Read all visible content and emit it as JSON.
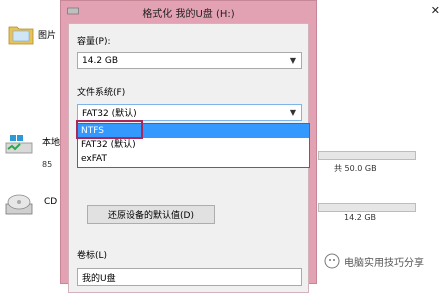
{
  "explorer": {
    "items": [
      {
        "label": "图片"
      },
      {
        "label": "本地"
      },
      {
        "label": "CD"
      }
    ],
    "drive_details": [
      {
        "prefix": "85",
        "free": "共 50.0 GB"
      },
      {
        "prefix": "",
        "free": "14.2 GB"
      }
    ],
    "close_symbol": "✕"
  },
  "dialog": {
    "title": "格式化 我的U盘 (H:)",
    "capacity_label": "容量(P):",
    "capacity_value": "14.2 GB",
    "filesystem_label": "文件系统(F)",
    "filesystem_value": "FAT32 (默认)",
    "filesystem_options": [
      "NTFS",
      "FAT32 (默认)",
      "exFAT"
    ],
    "highlighted_option": "NTFS",
    "restore_defaults_label": "还原设备的默认值(D)",
    "volume_label": "卷标(L)",
    "volume_value": "我的U盘"
  },
  "watermark": {
    "text": "电脑实用技巧分享"
  },
  "colors": {
    "dialog_frame": "#e3a2b4",
    "highlight": "#3399ff",
    "annotation_box": "#a8285a"
  }
}
